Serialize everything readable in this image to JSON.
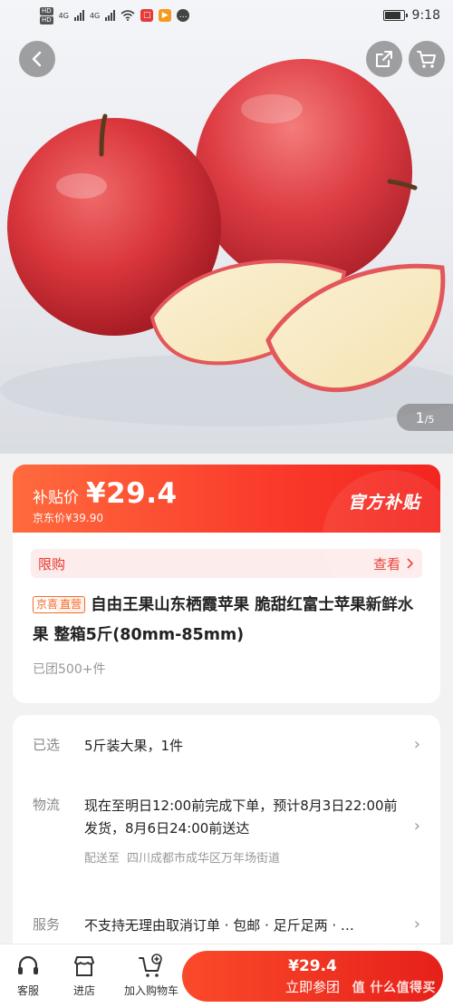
{
  "status_bar": {
    "sim_badges": [
      "HD",
      "HD"
    ],
    "network_1": "4G",
    "network_2": "4G",
    "time": "9:18",
    "battery_level": 0.85
  },
  "gallery": {
    "current": "1",
    "total": "/5"
  },
  "price_banner": {
    "subsidy_label": "补贴价",
    "price": "¥29.4",
    "original_price": "京东价¥39.90",
    "official_label": "官方补贴"
  },
  "limit": {
    "label": "限购",
    "more": "查看"
  },
  "product": {
    "tag_1": "京喜",
    "tag_2": "直营",
    "title": "自由王果山东栖霞苹果 脆甜红富士苹果新鲜水果 整箱5斤(80mm-85mm)",
    "sold": "已团500+件"
  },
  "details": {
    "selected_label": "已选",
    "selected_value": "5斤装大果，1件",
    "logistics_label": "物流",
    "logistics_value": "现在至明日12:00前完成下单，预计8月3日22:00前发货，8月6日24:00前送达",
    "ship_to_label": "配送至",
    "ship_to_value": "四川成都市成华区万年场街道",
    "service_label": "服务",
    "service_value": "不支持无理由取消订单 · 包邮 · 足斤足两 · …"
  },
  "bottom_bar": {
    "service": "客服",
    "store": "进店",
    "add_cart": "加入购物车",
    "buy_price": "¥29.4",
    "buy_label": "立即参团",
    "watermark": "值 什么值得买"
  },
  "colors": {
    "accent": "#f3251f",
    "banner_start": "#ff6a3d",
    "limit_bg": "#fdecec"
  }
}
